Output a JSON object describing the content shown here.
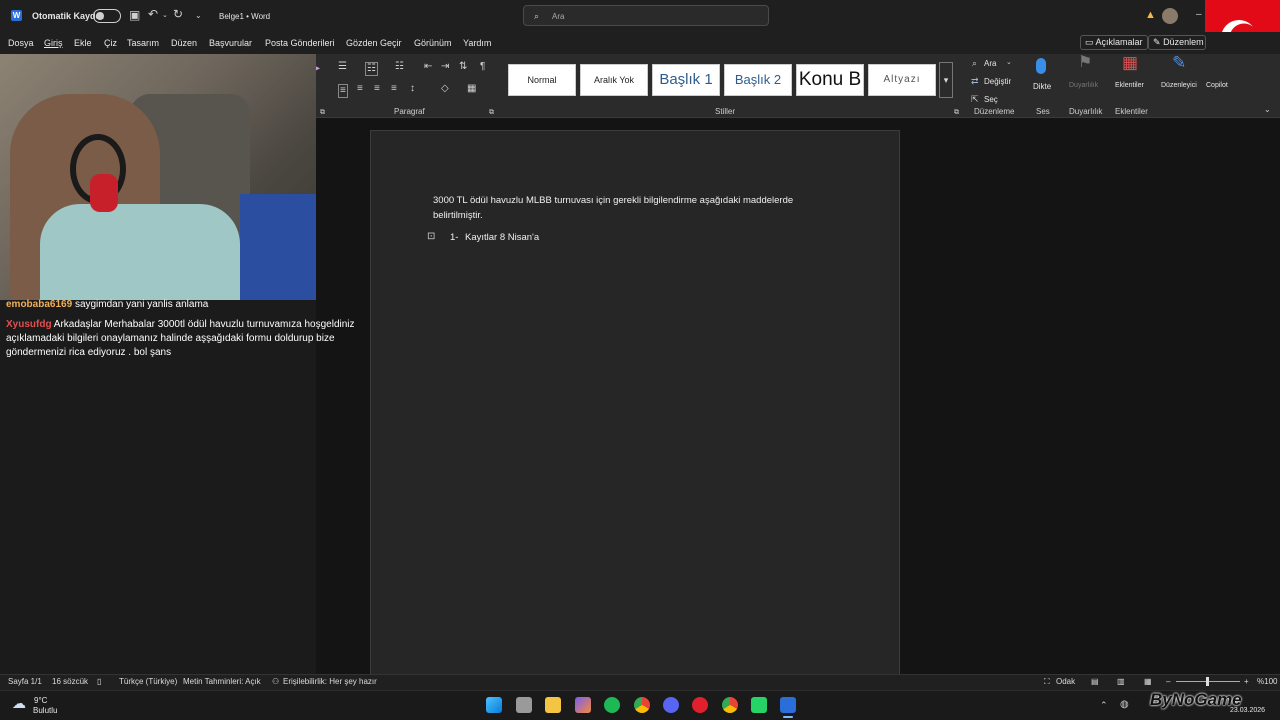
{
  "titlebar": {
    "autosave_label": "Otomatik Kaydet",
    "doc_title": "Belge1 • Word",
    "search_placeholder": "Ara"
  },
  "menu": [
    "Dosya",
    "Giriş",
    "Ekle",
    "Çiz",
    "Tasarım",
    "Düzen",
    "Başvurular",
    "Posta Gönderileri",
    "Gözden Geçir",
    "Görünüm",
    "Yardım"
  ],
  "menu_active": "Giriş",
  "top_right": {
    "comments_label": "Açıklamalar",
    "edit_label": "Düzenlem"
  },
  "ribbon": {
    "styles": [
      "Normal",
      "Aralık Yok",
      "Başlık 1",
      "Başlık 2",
      "Konu B",
      "Altyazı"
    ],
    "group_paragraph": "Paragraf",
    "group_styles": "Stiller",
    "find_label": "Ara",
    "replace_label": "Değiştir",
    "select_label": "Seç",
    "group_editing": "Düzenleme",
    "dictate_label": "Dikte",
    "group_voice": "Ses",
    "sensitivity_label": "Duyarlılık",
    "group_sensitivity": "Duyarlılık",
    "addins_label": "Eklentiler",
    "group_addins": "Eklentiler",
    "editor_label": "Düzenleyici",
    "copilot_label": "Copilot"
  },
  "document": {
    "paragraph": "3000 TL ödül havuzlu MLBB turnuvası için gerekli bilgilendirme aşağıdaki maddelerde belirtilmiştir.",
    "list_number": "1-",
    "list_item": "Kayıtlar 8 Nisan'a"
  },
  "chat": [
    {
      "user": "emobaba6169",
      "message": "saygimdan yani yanlis anlama"
    },
    {
      "user": "Xyusufdg",
      "message": "Arkadaşlar Merhabalar 3000tl ödül havuzlu turnuvamıza hoşgeldiniz açıklamadaki bilgileri onaylamanız halinde aşşağıdaki formu doldurup bize göndermenizi rica ediyoruz . bol şans"
    }
  ],
  "statusbar": {
    "page": "Sayfa 1/1",
    "words": "16 sözcük",
    "language": "Türkçe (Türkiye)",
    "predictions": "Metin Tahminleri: Açık",
    "accessibility": "Erişilebilirlik: Her şey hazır",
    "focus": "Odak",
    "zoom": "%100"
  },
  "taskbar": {
    "weather_temp": "9°C",
    "weather_desc": "Bulutlu",
    "date": "23.03.2026",
    "watermark": "ByNoGame"
  },
  "colors": {
    "flag_red": "#e30a17",
    "word_blue": "#2b6ed9"
  }
}
